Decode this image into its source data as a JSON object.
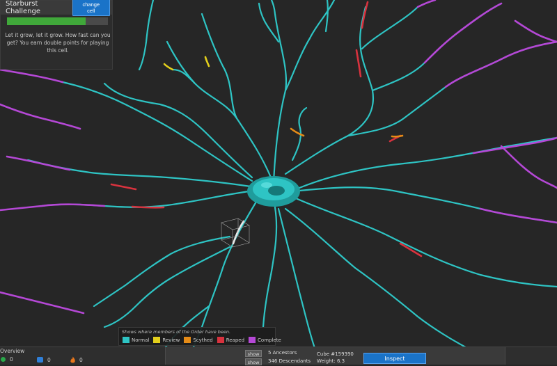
{
  "challenge": {
    "title": "Starburst Challenge",
    "change_cell_label": "change cell",
    "progress": 0.78,
    "description": "Let it grow, let it grow. How fast can you get? You earn double points for playing this cell."
  },
  "legend": {
    "caption": "Shows where members of the Order have been.",
    "items": [
      {
        "label": "Normal",
        "color": "#2ec4c4"
      },
      {
        "label": "Review",
        "color": "#e3cf1c"
      },
      {
        "label": "Scythed",
        "color": "#e58b17"
      },
      {
        "label": "Reaped",
        "color": "#d8323e"
      },
      {
        "label": "Complete",
        "color": "#b548d6"
      }
    ]
  },
  "overview": {
    "title": "Overview",
    "stats": [
      {
        "icon": "green-dot-icon",
        "value": "0",
        "color": "#2aa84a"
      },
      {
        "icon": "blue-cube-icon",
        "value": "0",
        "color": "#2f7fd8"
      },
      {
        "icon": "flame-icon",
        "value": "0",
        "color": "#e8771c"
      }
    ]
  },
  "lineage": {
    "show_label": "show",
    "ancestors": "5 Ancestors",
    "descendants": "346 Descendants"
  },
  "cube": {
    "id": "Cube #159390",
    "weight": "Weight: 6.3"
  },
  "inspect_label": "Inspect"
}
